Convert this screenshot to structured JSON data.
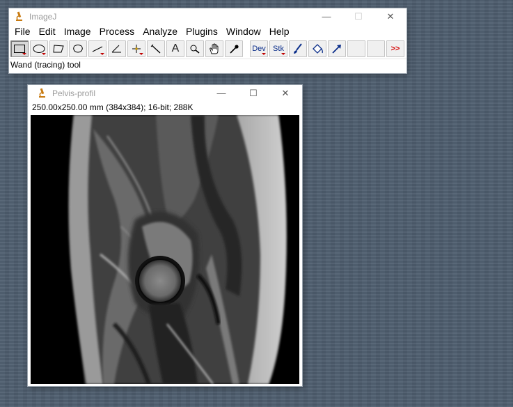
{
  "imagej": {
    "title": "ImageJ",
    "menus": [
      "File",
      "Edit",
      "Image",
      "Process",
      "Analyze",
      "Plugins",
      "Window",
      "Help"
    ],
    "tools": {
      "dev_label": "Dev",
      "stk_label": "Stk",
      "more_label": ">>",
      "text_tool_glyph": "A"
    },
    "status": "Wand (tracing) tool"
  },
  "image_window": {
    "title": "Pelvis-profil",
    "info": "250.00x250.00 mm (384x384); 16-bit; 288K"
  },
  "window_controls": {
    "minimize": "—",
    "maximize": "☐",
    "close": "✕"
  }
}
